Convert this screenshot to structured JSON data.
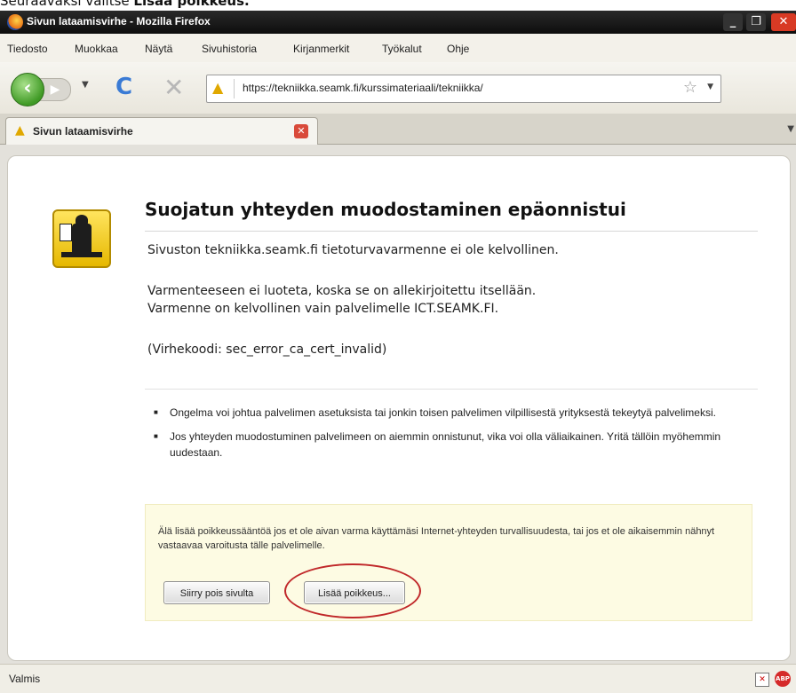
{
  "caption": {
    "prefix": "Seuraavaksi valitse ",
    "bold": "Lisää poikkeus."
  },
  "window": {
    "title": "Sivun lataamisvirhe - Mozilla Firefox"
  },
  "menu": [
    "Tiedosto",
    "Muokkaa",
    "Näytä",
    "Sivuhistoria",
    "Kirjanmerkit",
    "Työkalut",
    "Ohje"
  ],
  "navbar": {
    "url": "https://tekniikka.seamk.fi/kurssimateriaali/tekniikka/"
  },
  "tab": {
    "label": "Sivun lataamisvirhe"
  },
  "error": {
    "title": "Suojatun yhteyden muodostaminen epäonnistui",
    "line1": "Sivuston tekniikka.seamk.fi tietoturvavarmenne ei ole kelvollinen.",
    "line2": "Varmenteeseen ei luoteta, koska se on allekirjoitettu itsellään.",
    "line3": "Varmenne on kelvollinen vain palvelimelle ICT.SEAMK.FI.",
    "code": "(Virhekoodi: sec_error_ca_cert_invalid)",
    "bullets": [
      "Ongelma voi johtua palvelimen asetuksista tai jonkin toisen palvelimen vilpillisestä yrityksestä tekeytyä palvelimeksi.",
      "Jos yhteyden muodostuminen palvelimeen on aiemmin onnistunut, vika voi olla väliaikainen. Yritä tällöin myöhemmin uudestaan."
    ],
    "warning": "Älä lisää poikkeussääntöä jos et ole aivan varma käyttämäsi Internet-yhteyden turvallisuudesta, tai jos et ole aikaisemmin nähnyt vastaavaa varoitusta tälle palvelimelle.",
    "leave_button": "Siirry pois sivulta",
    "add_button": "Lisää poikkeus..."
  },
  "status": {
    "text": "Valmis"
  },
  "colors": {
    "annotation": "#c0282a",
    "warning_box": "#fdfbe3",
    "back_button": "#3f9a25"
  }
}
